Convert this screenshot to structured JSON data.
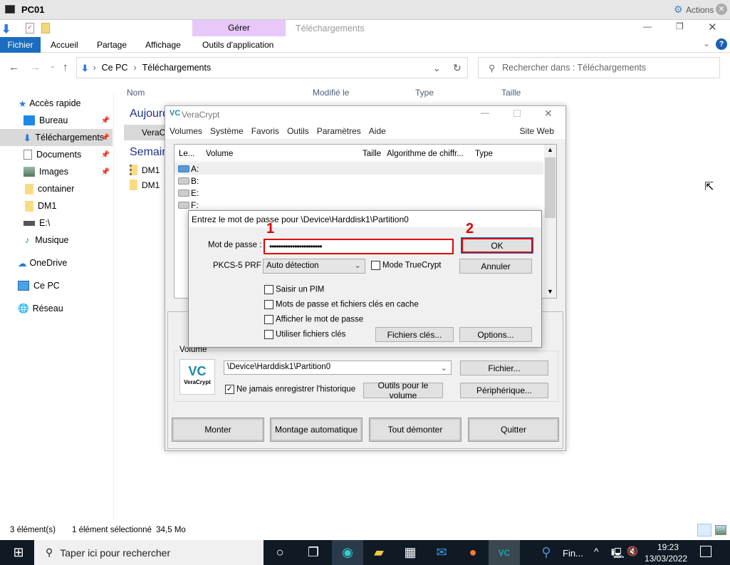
{
  "remote": {
    "title": "PC01",
    "actions": "Actions"
  },
  "explorer": {
    "context_tab": "Gérer",
    "window_title": "Téléchargements",
    "tabs": [
      "Fichier",
      "Accueil",
      "Partage",
      "Affichage",
      "Outils d'application"
    ],
    "breadcrumb": [
      "Ce PC",
      "Téléchargements"
    ],
    "search_placeholder": "Rechercher dans : Téléchargements",
    "columns": [
      "Nom",
      "Modifié le",
      "Type",
      "Taille"
    ],
    "groups": [
      {
        "label": "Aujourd'hui",
        "files": [
          "VeraCrypt"
        ]
      },
      {
        "label": "Semaine",
        "files": [
          "DM1",
          "DM1"
        ]
      }
    ],
    "sidebar": [
      "Accès rapide",
      "Bureau",
      "Téléchargements",
      "Documents",
      "Images",
      "container",
      "DM1",
      "E:\\",
      "Musique",
      "OneDrive",
      "Ce PC",
      "Réseau"
    ],
    "status": {
      "count": "3 élément(s)",
      "selected": "1 élément sélectionné  34,5 Mo"
    }
  },
  "veracrypt": {
    "title": "VeraCrypt",
    "menu": [
      "Volumes",
      "Système",
      "Favoris",
      "Outils",
      "Paramètres",
      "Aide"
    ],
    "site_web": "Site Web",
    "list_columns": [
      "Le...",
      "Volume",
      "Taille",
      "Algorithme de chiffr...",
      "Type"
    ],
    "drives": [
      "A:",
      "B:",
      "E:",
      "F:"
    ],
    "volume_group": "Volume",
    "logo_text": "VeraCrypt",
    "volume_path": "\\Device\\Harddisk1\\Partition0",
    "never_save_history": "Ne jamais enregistrer l'historique",
    "buttons": {
      "file": "Fichier...",
      "tools": "Outils pour le volume",
      "device": "Périphérique...",
      "mount": "Monter",
      "automount": "Montage automatique",
      "dismount_all": "Tout démonter",
      "quit": "Quitter"
    }
  },
  "password_dialog": {
    "title": "Entrez le mot de passe pour \\Device\\Harddisk1\\Partition0",
    "password_label": "Mot de passe :",
    "password_value": "•••••••••••••••••••••••",
    "prf_label": "PKCS-5 PRF :",
    "prf_value": "Auto détection",
    "truecrypt_mode": "Mode TrueCrypt",
    "ok": "OK",
    "cancel": "Annuler",
    "options_checkboxes": [
      "Saisir un PIM",
      "Mots de passe et fichiers clés en cache",
      "Afficher le mot de passe",
      "Utiliser fichiers clés"
    ],
    "keyfiles": "Fichiers clés...",
    "options": "Options...",
    "annotations": [
      "1",
      "2"
    ],
    "annotation_color": "#e00000"
  },
  "taskbar": {
    "search_placeholder": "Taper ici pour rechercher",
    "app_label": "Fin...",
    "time": "19:23",
    "date": "13/03/2022"
  }
}
